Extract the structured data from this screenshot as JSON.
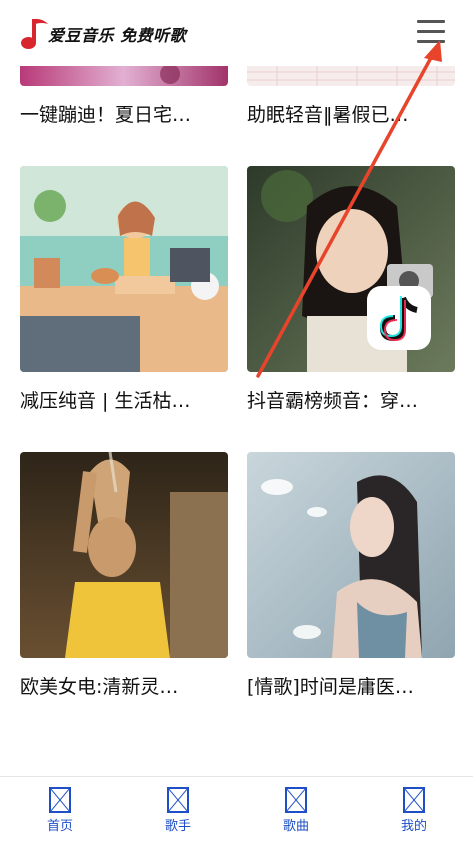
{
  "header": {
    "app_title": "爱豆音乐 免费听歌"
  },
  "playlists": [
    {
      "title": "一键蹦迪！夏日宅…"
    },
    {
      "title": "助眠轻音‖暑假已…"
    },
    {
      "title": "减压纯音 | 生活枯…"
    },
    {
      "title": "抖音霸榜频音：穿…"
    },
    {
      "title": "欧美女电:清新灵…"
    },
    {
      "title": "[情歌]时间是庸医…"
    }
  ],
  "bottom_nav": [
    {
      "label": "首页",
      "icon": "broken-image-icon"
    },
    {
      "label": "歌手",
      "icon": "broken-image-icon"
    },
    {
      "label": "歌曲",
      "icon": "broken-image-icon"
    },
    {
      "label": "我的",
      "icon": "broken-image-icon"
    }
  ],
  "colors": {
    "nav_accent": "#1e4fc7",
    "logo_red": "#d8262f",
    "annotation_arrow": "#e8442b"
  }
}
